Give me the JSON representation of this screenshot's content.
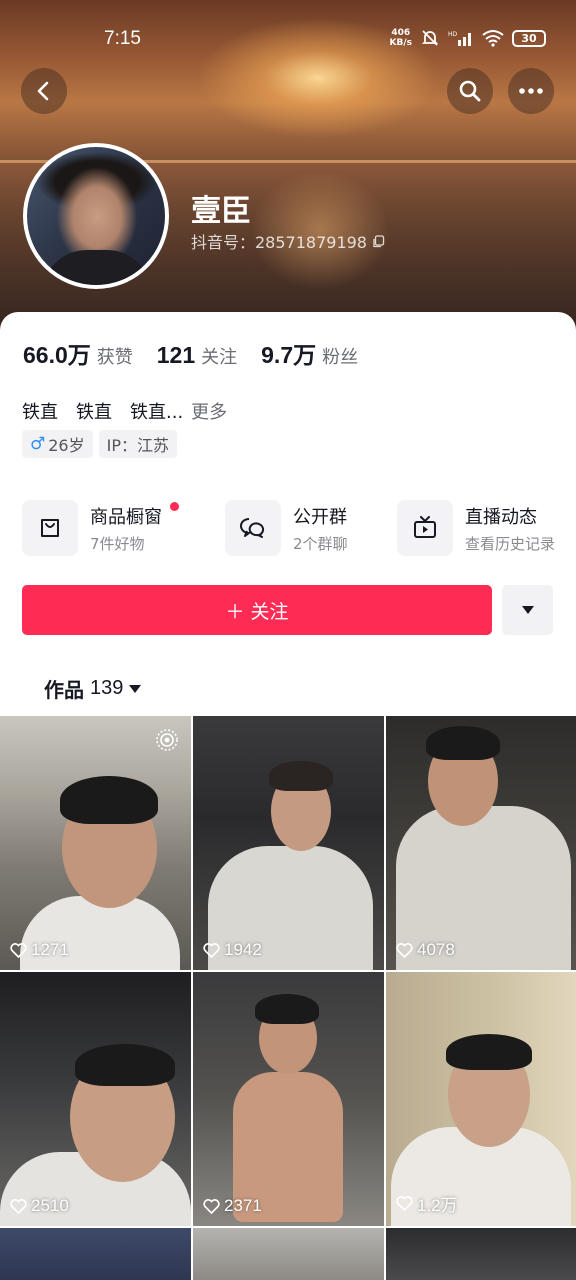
{
  "status_bar": {
    "time": "7:15",
    "net_speed_top": "406",
    "net_speed_bottom": "KB/s",
    "battery": "30"
  },
  "header": {
    "back_icon": "chevron-left-icon",
    "search_icon": "search-icon",
    "more_icon": "ellipsis-icon"
  },
  "profile": {
    "name": "壹臣",
    "douyin_id": "抖音号：2857187919​8"
  },
  "stats": [
    {
      "value": "66.0万",
      "label": "获赞"
    },
    {
      "value": "121",
      "label": "关注"
    },
    {
      "value": "9.7万",
      "label": "粉丝"
    }
  ],
  "bio": {
    "items": [
      "铁直",
      "铁直",
      "铁直..."
    ],
    "more": "更多"
  },
  "tags": {
    "gender_symbol": "♂",
    "age": "26岁",
    "ip": "IP：江苏"
  },
  "services": [
    {
      "title": "商品橱窗",
      "subtitle": "7件好物",
      "icon": "shopping-bag-icon",
      "has_dot": true
    },
    {
      "title": "公开群",
      "subtitle": "2个群聊",
      "icon": "chat-bubbles-icon",
      "has_dot": false
    },
    {
      "title": "直播动态",
      "subtitle": "查看历史记录",
      "icon": "tv-icon",
      "has_dot": false
    }
  ],
  "actions": {
    "follow_label": "＋ 关注",
    "more_dropdown_icon": "caret-down-icon"
  },
  "works_tab": {
    "label": "作品",
    "count": "139"
  },
  "videos": [
    {
      "likes": "1271",
      "live": true
    },
    {
      "likes": "1942",
      "live": false
    },
    {
      "likes": "4078",
      "live": false
    },
    {
      "likes": "2510",
      "live": false
    },
    {
      "likes": "2371",
      "live": false
    },
    {
      "likes": "1.2万",
      "live": false
    }
  ],
  "colors": {
    "accent": "#fe2c55",
    "text_primary": "#161823",
    "text_secondary": "#6b6d75"
  }
}
